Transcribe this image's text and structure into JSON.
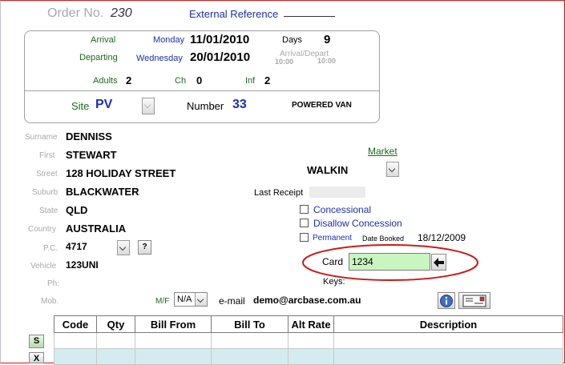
{
  "order": {
    "label": "Order No.",
    "number": "230",
    "external_ref_label": "External Reference"
  },
  "stay": {
    "arrival_label": "Arrival",
    "arrival_day": "Monday",
    "arrival_date": "11/01/2010",
    "departing_label": "Departing",
    "departing_day": "Wednesday",
    "departing_date": "20/01/2010",
    "days_label": "Days",
    "days": "9",
    "arrive_depart_label": "Arrival/Depart",
    "arrival_time": "10:00",
    "depart_time": "10:00",
    "adults_label": "Adults",
    "adults": "2",
    "ch_label": "Ch",
    "ch": "0",
    "inf_label": "Inf",
    "inf": "2",
    "site_label": "Site",
    "site": "PV",
    "number_label": "Number",
    "number": "33",
    "site_type": "POWERED VAN"
  },
  "guest": {
    "surname_label": "Surname",
    "surname": "DENNISS",
    "first_label": "First",
    "first": "STEWART",
    "street_label": "Street",
    "street": "128 HOLIDAY STREET",
    "suburb_label": "Suburb",
    "suburb": "BLACKWATER",
    "state_label": "State",
    "state": "QLD",
    "country_label": "Country",
    "country": "AUSTRALIA",
    "pc_label": "P.C.",
    "pc": "4717",
    "pc_button": "?",
    "vehicle_label": "Vehicle",
    "vehicle": "123UNI",
    "ph_label": "Ph:",
    "mob_label": "Mob.",
    "mf_label": "M/F",
    "mf_value": "N/A",
    "email_label": "e-mail",
    "email": "demo@arcbase.com.au"
  },
  "market": {
    "label": "Market",
    "value": "WALKIN",
    "last_receipt_label": "Last Receipt",
    "concessional_label": "Concessional",
    "disallow_label": "Disallow Concession",
    "permanent_label": "Permanent",
    "date_booked_label": "Date Booked",
    "date_booked": "18/12/2009",
    "card_label": "Card",
    "card_value": "1234",
    "keys_label": "Keys:"
  },
  "table": {
    "columns": [
      "Code",
      "Qty",
      "Bill From",
      "Bill To",
      "Alt Rate",
      "Description"
    ],
    "s_button": "S",
    "x_button": "X"
  },
  "colors": {
    "highlight_circle": "#d01818",
    "card_input": "#c8f5c0",
    "row_selected": "#d4ecef",
    "accent_blue": "#1a2eb8",
    "label_green": "#1a6a1a"
  }
}
